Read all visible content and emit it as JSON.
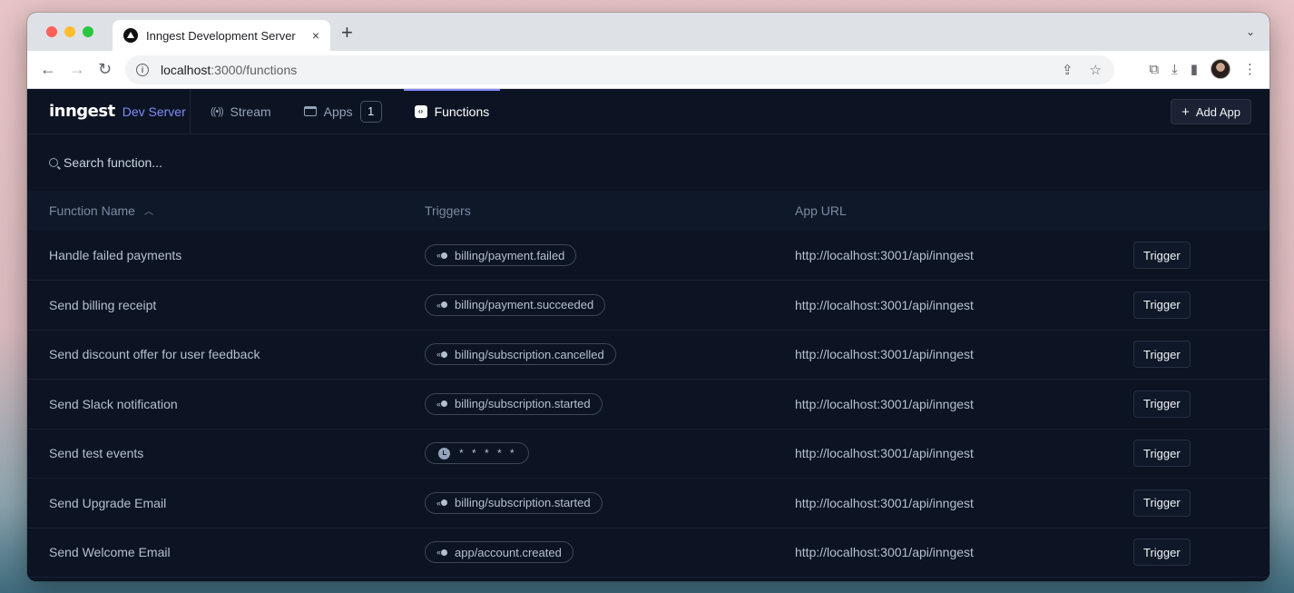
{
  "browser": {
    "tab_title": "Inngest Development Server",
    "tab_close": "×",
    "new_tab": "+",
    "tab_menu": "⌄",
    "url_host": "localhost",
    "url_path": ":3000/functions",
    "nav": {
      "back": "←",
      "forward": "→",
      "reload": "↻"
    },
    "icons": {
      "share": "⇪",
      "bookmark": "☆",
      "extensions": "⧉",
      "download": "⤓",
      "sidebar": "▮",
      "menu": "⋮"
    }
  },
  "header": {
    "logo": "inngest",
    "subtitle": "Dev Server",
    "nav": [
      {
        "label": "Stream",
        "icon": "stream-icon"
      },
      {
        "label": "Apps",
        "icon": "apps-icon",
        "badge": "1"
      },
      {
        "label": "Functions",
        "icon": "functions-icon",
        "active": true
      }
    ],
    "add_app_label": "Add App",
    "add_app_icon": "+"
  },
  "search": {
    "placeholder": "Search function..."
  },
  "table": {
    "columns": [
      "Function Name",
      "Triggers",
      "App URL",
      ""
    ],
    "sort_indicator": "^",
    "rows": [
      {
        "name": "Handle failed payments",
        "trigger_type": "event",
        "trigger": "billing/payment.failed",
        "url": "http://localhost:3001/api/inngest",
        "action": "Trigger"
      },
      {
        "name": "Send billing receipt",
        "trigger_type": "event",
        "trigger": "billing/payment.succeeded",
        "url": "http://localhost:3001/api/inngest",
        "action": "Trigger"
      },
      {
        "name": "Send discount offer for user feedback",
        "trigger_type": "event",
        "trigger": "billing/subscription.cancelled",
        "url": "http://localhost:3001/api/inngest",
        "action": "Trigger"
      },
      {
        "name": "Send Slack notification",
        "trigger_type": "event",
        "trigger": "billing/subscription.started",
        "url": "http://localhost:3001/api/inngest",
        "action": "Trigger"
      },
      {
        "name": "Send test events",
        "trigger_type": "cron",
        "trigger": "* * * * *",
        "url": "http://localhost:3001/api/inngest",
        "action": "Trigger"
      },
      {
        "name": "Send Upgrade Email",
        "trigger_type": "event",
        "trigger": "billing/subscription.started",
        "url": "http://localhost:3001/api/inngest",
        "action": "Trigger"
      },
      {
        "name": "Send Welcome Email",
        "trigger_type": "event",
        "trigger": "app/account.created",
        "url": "http://localhost:3001/api/inngest",
        "action": "Trigger"
      }
    ]
  },
  "colors": {
    "accent": "#818cf8",
    "background": "#0c1322",
    "header_row": "#0f1828"
  }
}
